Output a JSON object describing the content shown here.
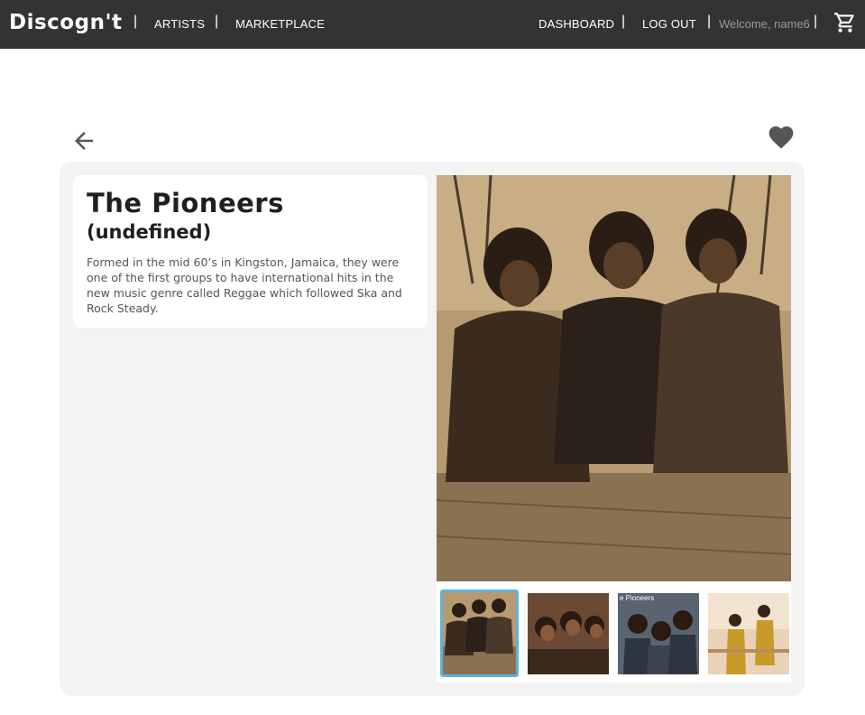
{
  "nav": {
    "logo": "Discogn't",
    "artists": "ARTISTS",
    "marketplace": "MARKETPLACE",
    "dashboard": "DASHBOARD",
    "logout": "LOG OUT",
    "welcome": "Welcome, name6",
    "separator": "|"
  },
  "artist": {
    "name": "The Pioneers",
    "subtitle": "(undefined)",
    "bio": "Formed in the mid 60’s in Kingston, Jamaica, they were one of the first groups to have international hits in the new music genre called Reggae which followed Ska and Rock Steady."
  },
  "colors": {
    "topbar": "#333333",
    "panel": "#f3f3f3",
    "selected_thumb_border": "#5bb4dc"
  },
  "icons": {
    "back": "arrow-left-icon",
    "favorite": "heart-icon",
    "cart": "shopping-cart-icon"
  }
}
